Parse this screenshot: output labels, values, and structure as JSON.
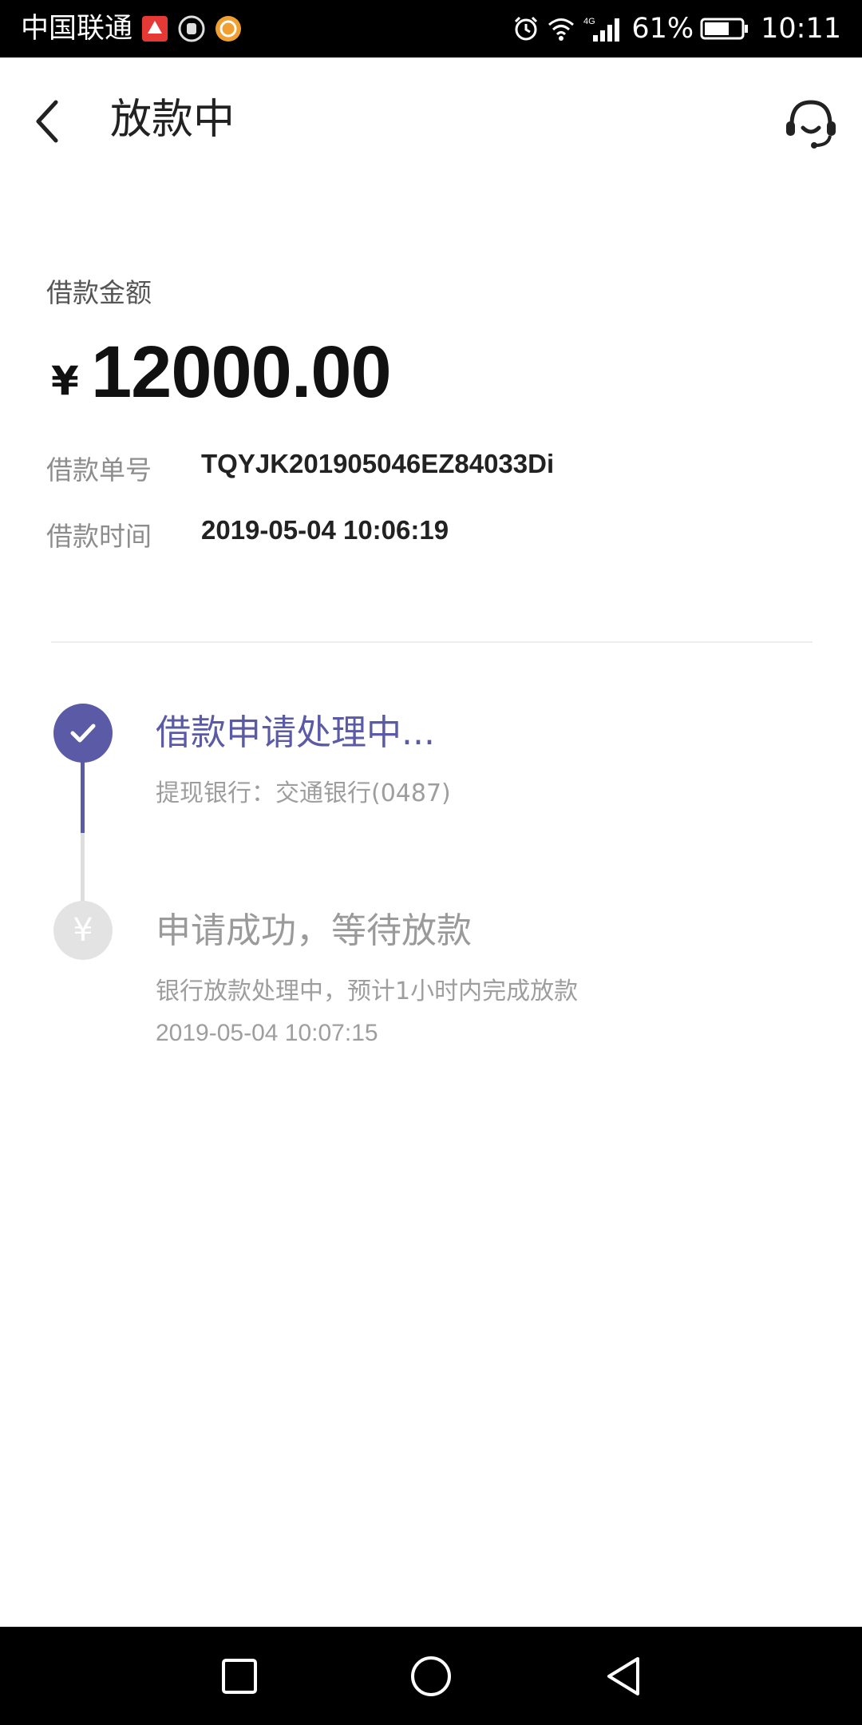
{
  "status_bar": {
    "carrier": "中国联通",
    "battery_percent": "61%",
    "time": "10:11",
    "network": "4G"
  },
  "app_bar": {
    "title": "放款中",
    "back_icon": "chevron-left-icon",
    "service_icon": "headset-icon"
  },
  "loan": {
    "amount_label": "借款金额",
    "currency": "¥",
    "amount": "12000.00",
    "order_label": "借款单号",
    "order_number": "TQYJK201905046EZ84033Di",
    "time_label": "借款时间",
    "loan_time": "2019-05-04 10:06:19"
  },
  "timeline": {
    "steps": [
      {
        "title": "借款申请处理中...",
        "subtitle": "提现银行：交通银行(0487)",
        "status": "active",
        "icon": "check-icon"
      },
      {
        "title": "申请成功，等待放款",
        "subtitle": "银行放款处理中，预计1小时内完成放款",
        "time": "2019-05-04 10:07:15",
        "status": "pending",
        "icon_text": "¥"
      }
    ]
  },
  "colors": {
    "accent": "#5b5aa6",
    "pending": "#e3e3e3",
    "muted_text": "#9e9e9e"
  }
}
